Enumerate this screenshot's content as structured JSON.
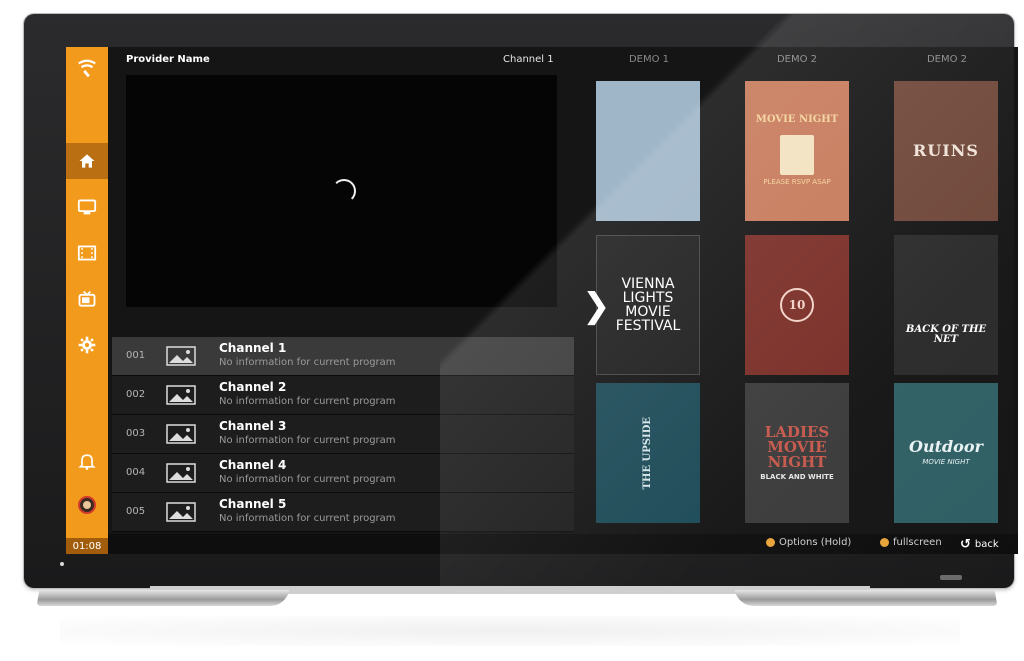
{
  "header": {
    "provider_name": "Provider Name",
    "current_channel": "Channel 1"
  },
  "clock": "01:08",
  "sidebar": {
    "items": [
      {
        "icon": "home-icon"
      },
      {
        "icon": "monitor-icon"
      },
      {
        "icon": "film-icon"
      },
      {
        "icon": "tv-icon"
      },
      {
        "icon": "gear-icon"
      },
      {
        "icon": "bell-icon"
      },
      {
        "icon": "avatar"
      }
    ]
  },
  "channels": [
    {
      "num": "001",
      "name": "Channel 1",
      "info": "No information for current program"
    },
    {
      "num": "002",
      "name": "Channel 2",
      "info": "No information for current program"
    },
    {
      "num": "003",
      "name": "Channel 3",
      "info": "No information for current program"
    },
    {
      "num": "004",
      "name": "Channel 4",
      "info": "No information for current program"
    },
    {
      "num": "005",
      "name": "Channel 5",
      "info": "No information for current program"
    }
  ],
  "grid": {
    "columns": [
      "DEMO 1",
      "DEMO 2",
      "DEMO 2"
    ],
    "posters": [
      {
        "title": "",
        "sub": "",
        "bg": "#9fb6c8",
        "fg": "#e0e8ee"
      },
      {
        "title": "MOVIE NIGHT",
        "sub": "PLEASE RSVP ASAP",
        "bg": "#c77a5b",
        "fg": "#f4d49c"
      },
      {
        "title": "RUINS",
        "sub": "",
        "bg": "#6e4638",
        "fg": "#f0e3d8"
      },
      {
        "title": "VIENNA LIGHTS MOVIE FESTIVAL",
        "sub": "",
        "bg": "#1f1f1f",
        "fg": "#ffffff"
      },
      {
        "title": "10",
        "sub": "",
        "bg": "#7a2e27",
        "fg": "#f2d2c8"
      },
      {
        "title": "BACK OF THE NET",
        "sub": "",
        "bg": "#2a2a2a",
        "fg": "#ffffff"
      },
      {
        "title": "THE UPSIDE",
        "sub": "",
        "bg": "#1c4a57",
        "fg": "#d7e6ea"
      },
      {
        "title": "LADIES MOVIE NIGHT",
        "sub": "BLACK AND WHITE",
        "bg": "#3b3b3b",
        "fg": "#e6e6e6"
      },
      {
        "title": "Outdoor",
        "sub": "MOVIE NIGHT",
        "bg": "#2f5f64",
        "fg": "#e9f2f2"
      }
    ]
  },
  "bottom": {
    "options_label": "Options (Hold)",
    "fullscreen_label": "fullscreen",
    "back_label": "back"
  },
  "colors": {
    "accent": "#f29a1c",
    "accent_dark": "#b96f12",
    "screen_bg": "#151515"
  }
}
